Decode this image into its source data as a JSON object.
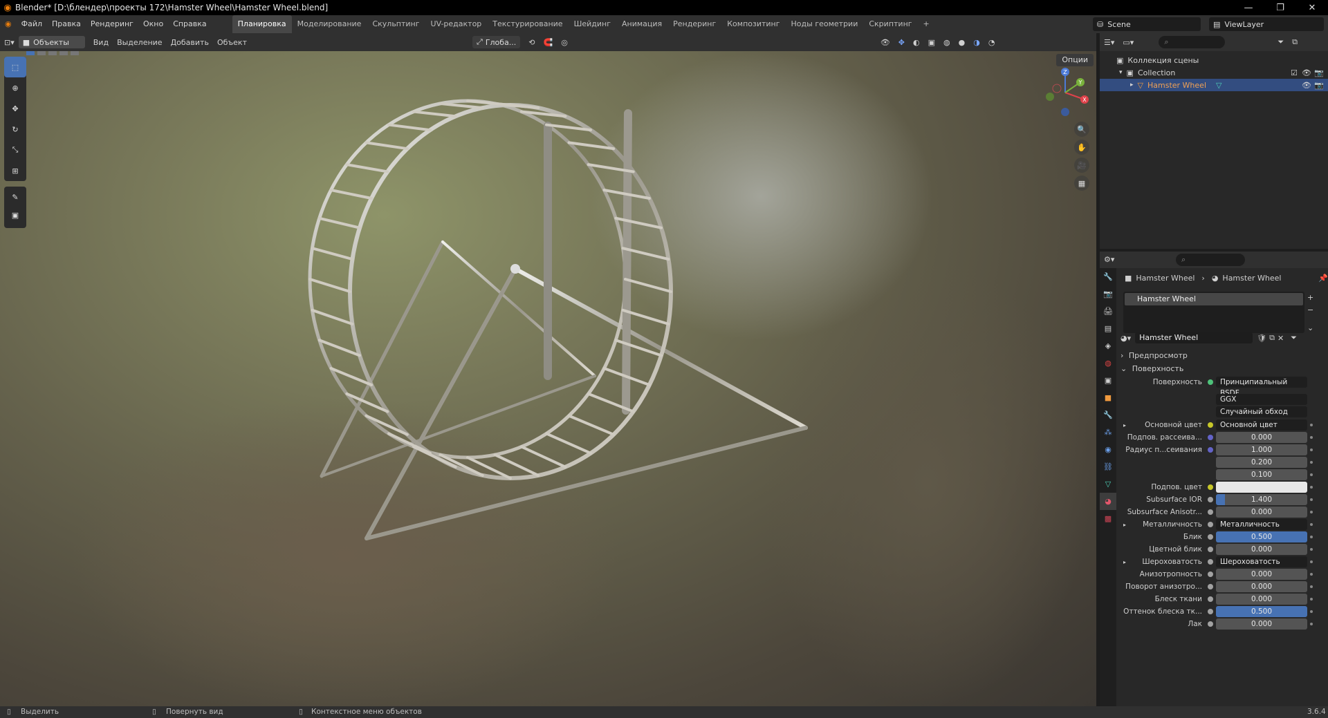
{
  "window": {
    "title": "Blender* [D:\\блендер\\проекты 172\\Hamster Wheel\\Hamster Wheel.blend]",
    "app_icon": "blender-logo-icon",
    "controls": [
      "minimize-icon",
      "maximize-icon",
      "close-icon"
    ]
  },
  "menu": {
    "items": [
      "Файл",
      "Правка",
      "Рендеринг",
      "Окно",
      "Справка"
    ],
    "workspaces": [
      "Планировка",
      "Моделирование",
      "Скульптинг",
      "UV-редактор",
      "Текстурирование",
      "Шейдинг",
      "Анимация",
      "Рендеринг",
      "Композитинг",
      "Ноды геометрии",
      "Скриптинг",
      "+"
    ],
    "active_workspace": "Планировка",
    "scene": "Scene",
    "view_layer": "ViewLayer"
  },
  "viewport_header": {
    "mode": "Объекты",
    "menus": [
      "Вид",
      "Выделение",
      "Добавить",
      "Объект"
    ],
    "transform_orientation": "Глоба...",
    "options": "Опции"
  },
  "gizmo": {
    "x": "X",
    "y": "Y",
    "z": "Z"
  },
  "outliner": {
    "root": "Коллекция сцены",
    "collection": "Collection",
    "object": "Hamster Wheel"
  },
  "properties": {
    "breadcrumb_object": "Hamster Wheel",
    "breadcrumb_material": "Hamster Wheel",
    "slot": "Hamster Wheel",
    "material_name": "Hamster Wheel",
    "panel_preview": "Предпросмотр",
    "panel_surface": "Поверхность",
    "surface_label": "Поверхность",
    "surface_value": "Принципиальный BSDF",
    "distribution": "GGX",
    "subsurface_method": "Случайный обход",
    "rows": [
      {
        "label": "Основной цвет",
        "value": "Основной цвет",
        "kind": "link",
        "dot": "#c7c729",
        "expand": true
      },
      {
        "label": "Подпов. рассеива...",
        "value": "0.000",
        "kind": "num",
        "dot": "#6363c7"
      },
      {
        "label": "Радиус п...сеивания",
        "value": "1.000",
        "kind": "num",
        "dot": "#6363c7"
      },
      {
        "label": "",
        "value": "0.200",
        "kind": "num",
        "dot": ""
      },
      {
        "label": "",
        "value": "0.100",
        "kind": "num",
        "dot": ""
      },
      {
        "label": "Подпов. цвет",
        "value": "",
        "kind": "white",
        "dot": "#c7c729"
      },
      {
        "label": "Subsurface IOR",
        "value": "1.400",
        "kind": "ior",
        "dot": "#a1a1a1"
      },
      {
        "label": "Subsurface Anisotr...",
        "value": "0.000",
        "kind": "num",
        "dot": "#a1a1a1"
      },
      {
        "label": "Металличность",
        "value": "Металличность",
        "kind": "link",
        "dot": "#a1a1a1",
        "expand": true
      },
      {
        "label": "Блик",
        "value": "0.500",
        "kind": "blue",
        "dot": "#a1a1a1"
      },
      {
        "label": "Цветной блик",
        "value": "0.000",
        "kind": "num",
        "dot": "#a1a1a1"
      },
      {
        "label": "Шероховатость",
        "value": "Шероховатость",
        "kind": "link",
        "dot": "#a1a1a1",
        "expand": true
      },
      {
        "label": "Анизотропность",
        "value": "0.000",
        "kind": "num",
        "dot": "#a1a1a1"
      },
      {
        "label": "Поворот анизотро...",
        "value": "0.000",
        "kind": "num",
        "dot": "#a1a1a1"
      },
      {
        "label": "Блеск ткани",
        "value": "0.000",
        "kind": "num",
        "dot": "#a1a1a1"
      },
      {
        "label": "Оттенок блеска тк...",
        "value": "0.500",
        "kind": "blue",
        "dot": "#a1a1a1"
      },
      {
        "label": "Лак",
        "value": "0.000",
        "kind": "num",
        "dot": "#a1a1a1"
      }
    ]
  },
  "status": {
    "left": "Выделить",
    "mid": "Повернуть вид",
    "right": "Контекстное меню объектов",
    "version": "3.6.4"
  }
}
